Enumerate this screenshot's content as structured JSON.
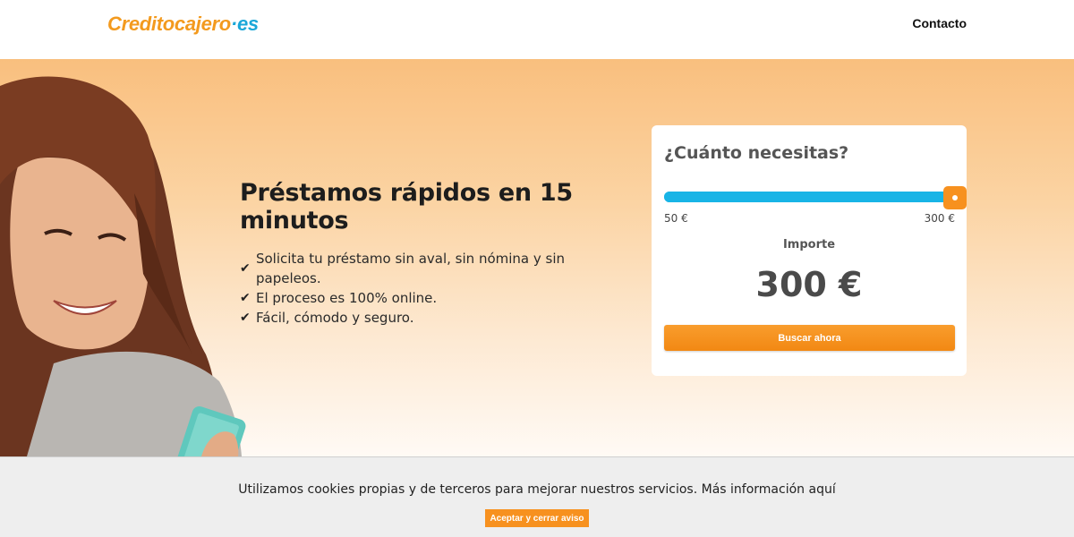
{
  "header": {
    "logo_part1": "Creditocajero",
    "logo_part2": "·es",
    "nav_contact": "Contacto"
  },
  "hero": {
    "title": "Préstamos rápidos en 15 minutos",
    "features": [
      "Solicita tu préstamo sin aval, sin nómina y sin papeleos.",
      "El proceso es 100% online.",
      "Fácil, cómodo y seguro."
    ]
  },
  "calculator": {
    "title": "¿Cuánto necesitas?",
    "min_label": "50 €",
    "max_label": "300 €",
    "min_value": 50,
    "max_value": 300,
    "current_value": 300,
    "amount_label": "Importe",
    "amount_value": "300 €",
    "button_label": "Buscar ahora"
  },
  "cookie_bar": {
    "text": "Utilizamos cookies propias y de terceros para mejorar nuestros servicios.",
    "link_text": "Más información aquí",
    "button_label": "Aceptar y cerrar aviso"
  },
  "colors": {
    "brand_orange": "#f7911f",
    "brand_blue": "#18b4e6"
  }
}
